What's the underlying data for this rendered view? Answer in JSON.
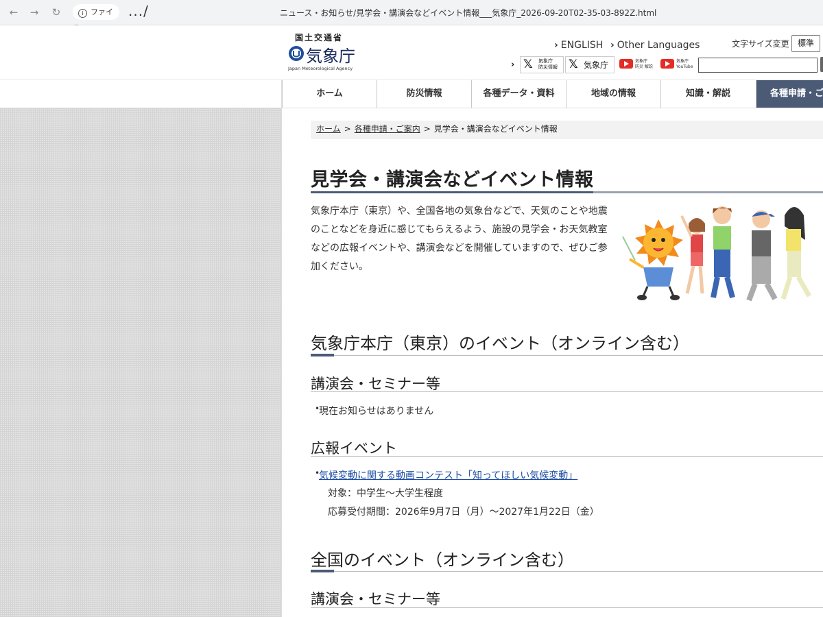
{
  "browser": {
    "back_icon": "arrow-left-icon",
    "forward_icon": "arrow-right-icon",
    "reload_icon": "reload-icon",
    "info_label": "ファイル",
    "path_prefix": ".../",
    "url": "ニュース・お知らせ/見学会・講演会などイベント情報___気象庁_2026-09-20T02-35-03-892Z.html"
  },
  "header": {
    "ministry": "国土交通省",
    "agency": "気象庁",
    "agency_en": "Japan Meteorological Agency",
    "lang_english": "ENGLISH",
    "lang_other": "Other Languages",
    "font_size_label": "文字サイズ変更",
    "font_size_button": "標準",
    "x_disaster_line1": "気象庁",
    "x_disaster_line2": "防災情報",
    "x_jma": "気象庁",
    "yt1_line1": "気象庁",
    "yt1_line2": "防災 解説",
    "yt2_line1": "気象庁",
    "yt2_line2": "YouTube"
  },
  "gnav": [
    "ホーム",
    "防災情報",
    "各種データ・資料",
    "地域の情報",
    "知識・解説",
    "各種申請・ご案内"
  ],
  "breadcrumb": {
    "home": "ホーム",
    "parent": "各種申請・ご案内",
    "sep": ">",
    "current": "見学会・講演会などイベント情報"
  },
  "page": {
    "title": "見学会・講演会などイベント情報",
    "intro": "気象庁本庁（東京）や、全国各地の気象台などで、天気のことや地震のことなどを身近に感じてもらえるよう、施設の見学会・お天気教室などの広報イベントや、講演会などを開催していますので、ぜひご参加ください。"
  },
  "sections": {
    "hq": {
      "title": "気象庁本庁（東京）のイベント（オンライン含む）",
      "seminars_title": "講演会・セミナー等",
      "seminars_empty": "現在お知らせはありません",
      "pr_title": "広報イベント",
      "pr_link": "気候変動に関する動画コンテスト「知ってほしい気候変動」",
      "pr_target": "対象：中学生～大学生程度",
      "pr_period": "応募受付期間：2026年9月7日（月）～2027年1月22日（金）"
    },
    "nationwide": {
      "title": "全国のイベント（オンライン含む）",
      "seminars_title": "講演会・セミナー等"
    }
  }
}
